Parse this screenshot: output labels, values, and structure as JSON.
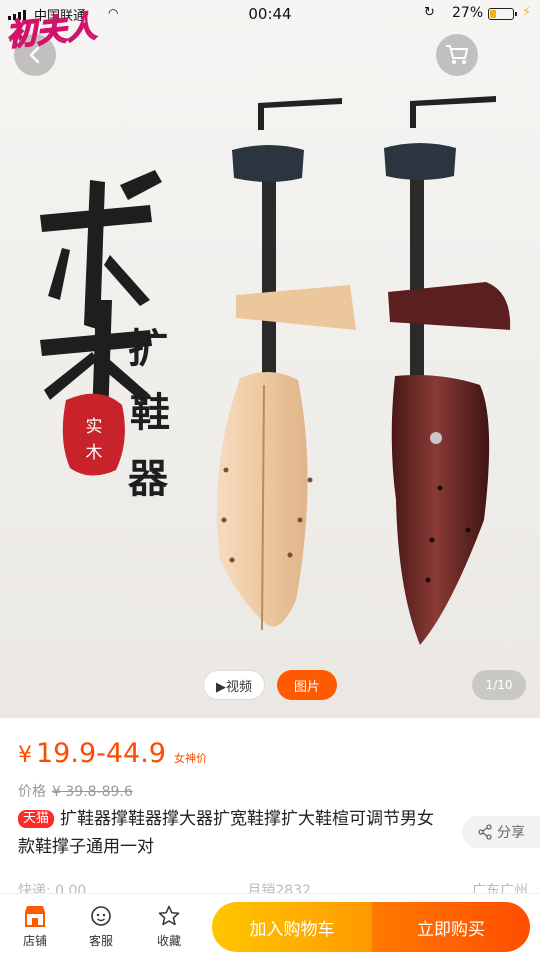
{
  "status_bar": {
    "carrier": "中国联通",
    "time": "00:44",
    "battery": "27%",
    "battery_level": 0.27
  },
  "watermark": "初夫人",
  "nav": {
    "back_icon": "chevron-left-icon",
    "cart_icon": "cart-icon"
  },
  "hero": {
    "headline_chars": [
      "松",
      "木"
    ],
    "subline_chars": [
      "扩",
      "鞋",
      "器"
    ],
    "seal_text": "实木",
    "colors": {
      "light_wood": "#edcaa0",
      "dark_wood": "#6a2a28",
      "ink": "#1e1e1e",
      "seal": "#c8222b"
    }
  },
  "media": {
    "video_label": "▶视频",
    "image_label": "图片",
    "counter": "1/10"
  },
  "price": {
    "currency": "¥",
    "value": "19.9-44.9",
    "tag": "女神价",
    "original_label": "价格",
    "original_value": "¥ 39.8-89.6"
  },
  "product": {
    "badge": "天猫",
    "title": "扩鞋器撑鞋器撑大器扩宽鞋撑扩大鞋楦可调节男女款鞋撑子通用一对",
    "share_label": "分享"
  },
  "meta": {
    "shipping": "快递: 0.00",
    "sales": "月销2832",
    "location": "广东广州"
  },
  "bottom_bar": {
    "store_label": "店铺",
    "service_label": "客服",
    "favorite_label": "收藏",
    "add_cart_label": "加入购物车",
    "buy_now_label": "立即购买",
    "colors": {
      "cart_start": "#ffc600",
      "cart_end": "#ff9a00",
      "buy_start": "#ff7a00",
      "buy_end": "#ff4d00",
      "accent": "#ff5a00"
    }
  }
}
